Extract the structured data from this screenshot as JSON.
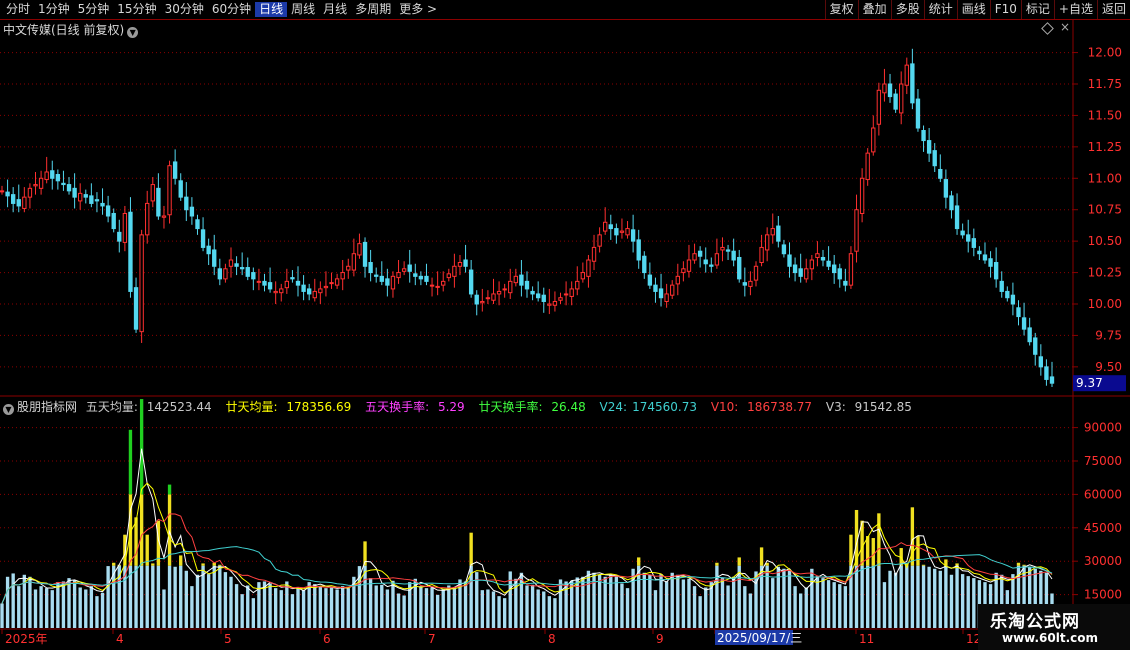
{
  "toolbar": {
    "periods": [
      "分时",
      "1分钟",
      "5分钟",
      "15分钟",
      "30分钟",
      "60分钟",
      "日线",
      "周线",
      "月线",
      "多周期",
      "更多 >"
    ],
    "active_period": "日线",
    "actions": [
      "复权",
      "叠加",
      "多股",
      "统计",
      "画线",
      "F10",
      "标记",
      "+自选",
      "返回"
    ]
  },
  "main_title": "中文传媒(日线 前复权)",
  "price_axis": {
    "labels": [
      "12.00",
      "11.75",
      "11.50",
      "11.25",
      "11.00",
      "10.75",
      "10.50",
      "10.25",
      "10.00",
      "9.75",
      "9.50"
    ],
    "current_price": "9.37"
  },
  "indicator": {
    "name": "股朋指标网",
    "fields": [
      {
        "label": "五天均量:",
        "value": "142523.44",
        "color": "#ffffff"
      },
      {
        "label": "廿天均量:",
        "value": "178356.69",
        "color": "#ffff00"
      },
      {
        "label": "五天换手率:",
        "value": "5.29",
        "color": "#ff40ff"
      },
      {
        "label": "廿天换手率:",
        "value": "26.48",
        "color": "#40ff40"
      },
      {
        "label": "V24:",
        "value": "174560.73",
        "color": "#40d0d0"
      },
      {
        "label": "V10:",
        "value": "186738.77",
        "color": "#ff4040"
      },
      {
        "label": "V3:",
        "value": "91542.85",
        "color": "#c8c8c8"
      }
    ]
  },
  "volume_axis": {
    "labels": [
      "90000",
      "75000",
      "60000",
      "45000",
      "30000",
      "15000"
    ]
  },
  "date_axis": {
    "labels": [
      "2025年",
      "4",
      "5",
      "6",
      "7",
      "8",
      "9",
      "2025/09/17/三",
      "11",
      "12"
    ]
  },
  "watermark": {
    "title": "乐淘公式网",
    "url": "www.60lt.com"
  },
  "colors": {
    "up": "#ff3030",
    "down": "#54d8f0",
    "grid": "#8b0000",
    "axis_text": "#ff3030",
    "vol_light": "#a8dcf0",
    "vol_yellow": "#f0e020",
    "vol_green": "#20d020",
    "vol_blue": "#2020e0"
  },
  "chart_data": {
    "type": "candlestick",
    "ylim": [
      9.3,
      12.1
    ],
    "closes": [
      10.9,
      10.86,
      10.8,
      10.78,
      10.85,
      10.92,
      10.95,
      11.0,
      11.05,
      11.0,
      10.98,
      10.95,
      10.9,
      10.85,
      10.88,
      10.85,
      10.8,
      10.82,
      10.78,
      10.7,
      10.6,
      10.5,
      10.72,
      10.1,
      9.8,
      10.55,
      10.8,
      10.95,
      10.7,
      10.7,
      11.1,
      11.0,
      10.85,
      10.75,
      10.7,
      10.6,
      10.45,
      10.4,
      10.3,
      10.2,
      10.28,
      10.35,
      10.3,
      10.28,
      10.22,
      10.2,
      10.18,
      10.15,
      10.12,
      10.1,
      10.12,
      10.18,
      10.2,
      10.15,
      10.1,
      10.08,
      10.1,
      10.12,
      10.14,
      10.17,
      10.2,
      10.25,
      10.3,
      10.4,
      10.48,
      10.3,
      10.25,
      10.22,
      10.18,
      10.15,
      10.22,
      10.25,
      10.28,
      10.26,
      10.22,
      10.2,
      10.18,
      10.15,
      10.14,
      10.18,
      10.24,
      10.3,
      10.33,
      10.3,
      10.08,
      10.0,
      10.02,
      10.05,
      10.08,
      10.1,
      10.12,
      10.18,
      10.22,
      10.15,
      10.12,
      10.08,
      10.05,
      10.02,
      10.0,
      10.02,
      10.05,
      10.08,
      10.12,
      10.18,
      10.25,
      10.35,
      10.45,
      10.55,
      10.65,
      10.6,
      10.55,
      10.58,
      10.6,
      10.5,
      10.35,
      10.25,
      10.15,
      10.1,
      10.05,
      10.08,
      10.15,
      10.22,
      10.28,
      10.35,
      10.4,
      10.38,
      10.32,
      10.3,
      10.4,
      10.45,
      10.42,
      10.35,
      10.2,
      10.15,
      10.18,
      10.3,
      10.45,
      10.55,
      10.6,
      10.5,
      10.4,
      10.3,
      10.25,
      10.22,
      10.28,
      10.35,
      10.4,
      10.35,
      10.3,
      10.25,
      10.2,
      10.15,
      10.4,
      10.75,
      11.0,
      11.2,
      11.4,
      11.7,
      11.75,
      11.65,
      11.55,
      11.75,
      11.9,
      11.6,
      11.4,
      11.3,
      11.2,
      11.1,
      11.0,
      10.85,
      10.75,
      10.6,
      10.55,
      10.5,
      10.45,
      10.4,
      10.35,
      10.3,
      10.2,
      10.1,
      10.05,
      10.0,
      9.9,
      9.8,
      9.7,
      9.6,
      9.5,
      9.4,
      9.37
    ]
  }
}
